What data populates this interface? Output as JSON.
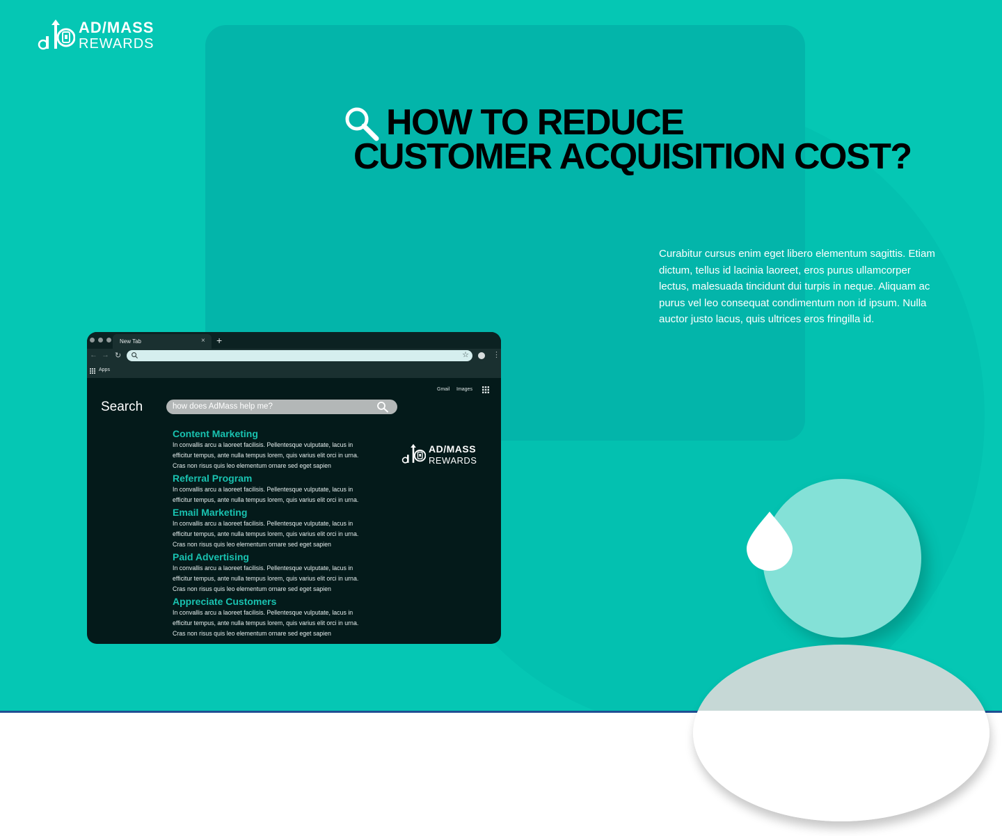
{
  "brand": {
    "line1": "AD/MASS",
    "line2": "REWARDS"
  },
  "heading": {
    "line1": "HOW TO REDUCE",
    "line2": "CUSTOMER ACQUISITION COST?"
  },
  "description": "Curabitur cursus enim eget libero elementum sagittis. Etiam dictum, tellus id lacinia laoreet, eros purus ullamcorper lectus, malesuada tincidunt dui turpis in neque. Aliquam ac purus vel leo consequat condimentum non id ipsum. Nulla auctor justo lacus, quis ultrices eros fringilla id.",
  "browser": {
    "tab_title": "New Tab",
    "tab_close": "×",
    "new_tab": "+",
    "bookmarks_apps": "Apps",
    "top_links": [
      "Gmail",
      "Images"
    ],
    "search_label": "Search",
    "search_query": "how does AdMass help me?",
    "results": [
      {
        "title": "Content Marketing",
        "snippet": [
          "In convallis arcu a laoreet facilisis. Pellentesque vulputate, lacus in",
          "efficitur tempus, ante nulla tempus lorem, quis varius elit orci in urna.",
          "Cras non risus quis leo elementum ornare sed eget sapien"
        ]
      },
      {
        "title": "Referral Program",
        "snippet": [
          "In convallis arcu a laoreet facilisis. Pellentesque vulputate, lacus in",
          "efficitur tempus, ante nulla tempus lorem, quis varius elit orci in urna."
        ]
      },
      {
        "title": "Email Marketing",
        "snippet": [
          "In convallis arcu a laoreet facilisis. Pellentesque vulputate, lacus in",
          "efficitur tempus, ante nulla tempus lorem, quis varius elit orci in urna.",
          "Cras non risus quis leo elementum ornare sed eget sapien"
        ]
      },
      {
        "title": "Paid Advertising",
        "snippet": [
          "In convallis arcu a laoreet facilisis. Pellentesque vulputate, lacus in",
          "efficitur tempus, ante nulla tempus lorem, quis varius elit orci in urna.",
          "Cras non risus quis leo elementum ornare sed eget sapien"
        ]
      },
      {
        "title": "Appreciate Customers",
        "snippet": [
          "In convallis arcu a laoreet facilisis. Pellentesque vulputate, lacus in",
          "efficitur tempus, ante nulla tempus lorem, quis varius elit orci in urna.",
          "Cras non risus quis leo elementum ornare sed eget sapien"
        ]
      }
    ]
  },
  "icons": {
    "logo": "admass-logo-icon",
    "title": "magnifier-icon",
    "search": "search-icon",
    "drop": "water-drop-icon"
  },
  "colors": {
    "background": "#05c7b4",
    "panel": "#03b5aa",
    "browser": "#041a1a",
    "result_title": "#19c2b0",
    "mint": "#84e1d7",
    "divider": "#1f4f93"
  }
}
